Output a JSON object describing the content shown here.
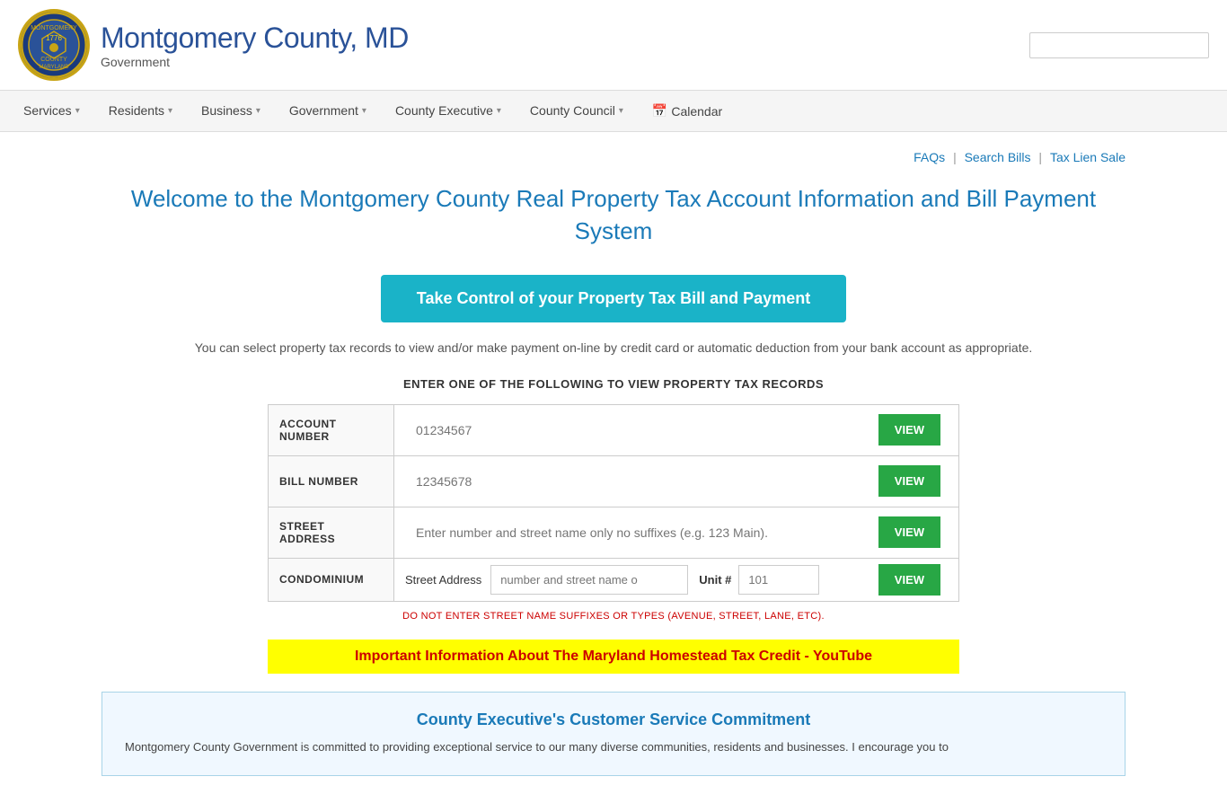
{
  "header": {
    "site_title": "Montgomery County, MD",
    "site_subtitle": "Government",
    "search_placeholder": ""
  },
  "nav": {
    "items": [
      {
        "label": "Services",
        "has_dropdown": true
      },
      {
        "label": "Residents",
        "has_dropdown": true
      },
      {
        "label": "Business",
        "has_dropdown": true
      },
      {
        "label": "Government",
        "has_dropdown": true
      },
      {
        "label": "County Executive",
        "has_dropdown": true
      },
      {
        "label": "County Council",
        "has_dropdown": true
      },
      {
        "label": "Calendar",
        "has_dropdown": false,
        "has_icon": true
      }
    ]
  },
  "top_links": [
    {
      "label": "FAQs"
    },
    {
      "label": "Search Bills"
    },
    {
      "label": "Tax Lien Sale"
    }
  ],
  "page": {
    "title": "Welcome to the Montgomery County Real Property Tax Account Information and Bill Payment System",
    "cta_button": "Take Control of your Property Tax Bill and Payment",
    "subtitle": "You can select property tax records to view and/or make payment on-line by credit card or automatic deduction from your bank account as appropriate.",
    "form_section_title": "ENTER ONE OF THE FOLLOWING TO VIEW PROPERTY TAX RECORDS",
    "fields": [
      {
        "label": "ACCOUNT NUMBER",
        "placeholder": "01234567",
        "type": "text",
        "button": "VIEW"
      },
      {
        "label": "BILL NUMBER",
        "placeholder": "12345678",
        "type": "text",
        "button": "VIEW"
      },
      {
        "label": "STREET ADDRESS",
        "placeholder": "Enter number and street name only no suffixes (e.g. 123 Main).",
        "type": "text",
        "button": "VIEW"
      }
    ],
    "condo_label": "CONDOMINIUM",
    "condo_street_label": "Street Address",
    "condo_street_placeholder": "number and street name o",
    "condo_unit_label": "Unit #",
    "condo_unit_placeholder": "101",
    "condo_button": "VIEW",
    "warning": "DO NOT ENTER STREET NAME SUFFIXES OR TYPES (AVENUE, STREET, LANE, ETC).",
    "yellow_notice": "Important Information About The Maryland Homestead Tax Credit - YouTube",
    "info_box_title": "County Executive's Customer Service Commitment",
    "info_box_text": "Montgomery County Government is committed to providing exceptional service to our many diverse communities, residents and businesses. I encourage you to"
  }
}
